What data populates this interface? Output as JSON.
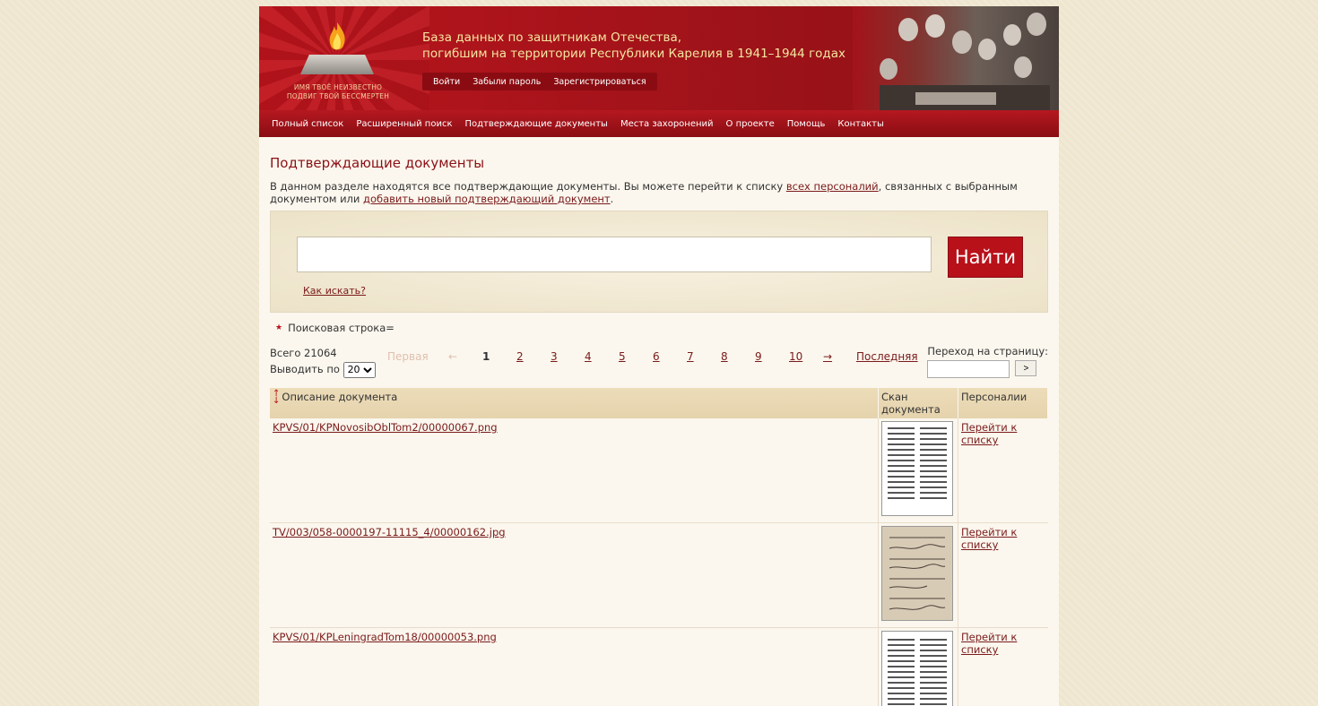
{
  "header": {
    "logo_text_line1": "ИМЯ ТВОЁ НЕИЗВЕСТНО",
    "logo_text_line2": "ПОДВИГ ТВОЙ БЕССМЕРТЕН",
    "title_line1": "База данных по защитникам Отечества,",
    "title_line2": "погибшим на территории Республики Карелия в 1941–1944 годах",
    "auth": {
      "login": "Войти",
      "forgot": "Забыли пароль",
      "register": "Зарегистрироваться"
    }
  },
  "nav": {
    "items": [
      "Полный список",
      "Расширенный поиск",
      "Подтверждающие документы",
      "Места захоронений",
      "О проекте",
      "Помощь",
      "Контакты"
    ]
  },
  "main": {
    "title": "Подтверждающие документы",
    "intro_part1": "В данном разделе находятся все подтверждающие документы. Вы можете перейти к списку ",
    "intro_link1": "всех персоналий",
    "intro_part2": ", связанных с выбранным документом или ",
    "intro_link2": "добавить новый подтверждающий документ",
    "intro_part3": "."
  },
  "search": {
    "value": "",
    "button_label": "Найти",
    "how_link": "Как искать?",
    "query_label": "Поисковая строка="
  },
  "pager": {
    "total": "Всего 21064",
    "per_page_label": "Выводить по",
    "per_page_value": "20",
    "first": "Первая",
    "prev": "←",
    "pages": [
      "1",
      "2",
      "3",
      "4",
      "5",
      "6",
      "7",
      "8",
      "9",
      "10"
    ],
    "current": "1",
    "next": "→",
    "last": "Последняя",
    "goto_label": "Переход на страницу:",
    "goto_value": "",
    "goto_button": ">"
  },
  "table": {
    "columns": [
      "Описание документа",
      "Скан документа",
      "Персоналии"
    ],
    "rows": [
      {
        "description": "KPVS/01/KPNovosibOblTom2/00000067.png",
        "scan_style": "printed-page",
        "link": "Перейти к списку"
      },
      {
        "description": "TV/003/058-0000197-11115_4/00000162.jpg",
        "scan_style": "handwritten-form",
        "link": "Перейти к списку"
      },
      {
        "description": "KPVS/01/KPLeningradTom18/00000053.png",
        "scan_style": "printed-page",
        "link": "Перейти к списку"
      }
    ]
  },
  "colors": {
    "brand_red": "#b8111a",
    "dark_red": "#8a0d13",
    "link": "#7a1a1a",
    "title_yellow": "#f3e6a0",
    "background": "#efe6cf"
  }
}
